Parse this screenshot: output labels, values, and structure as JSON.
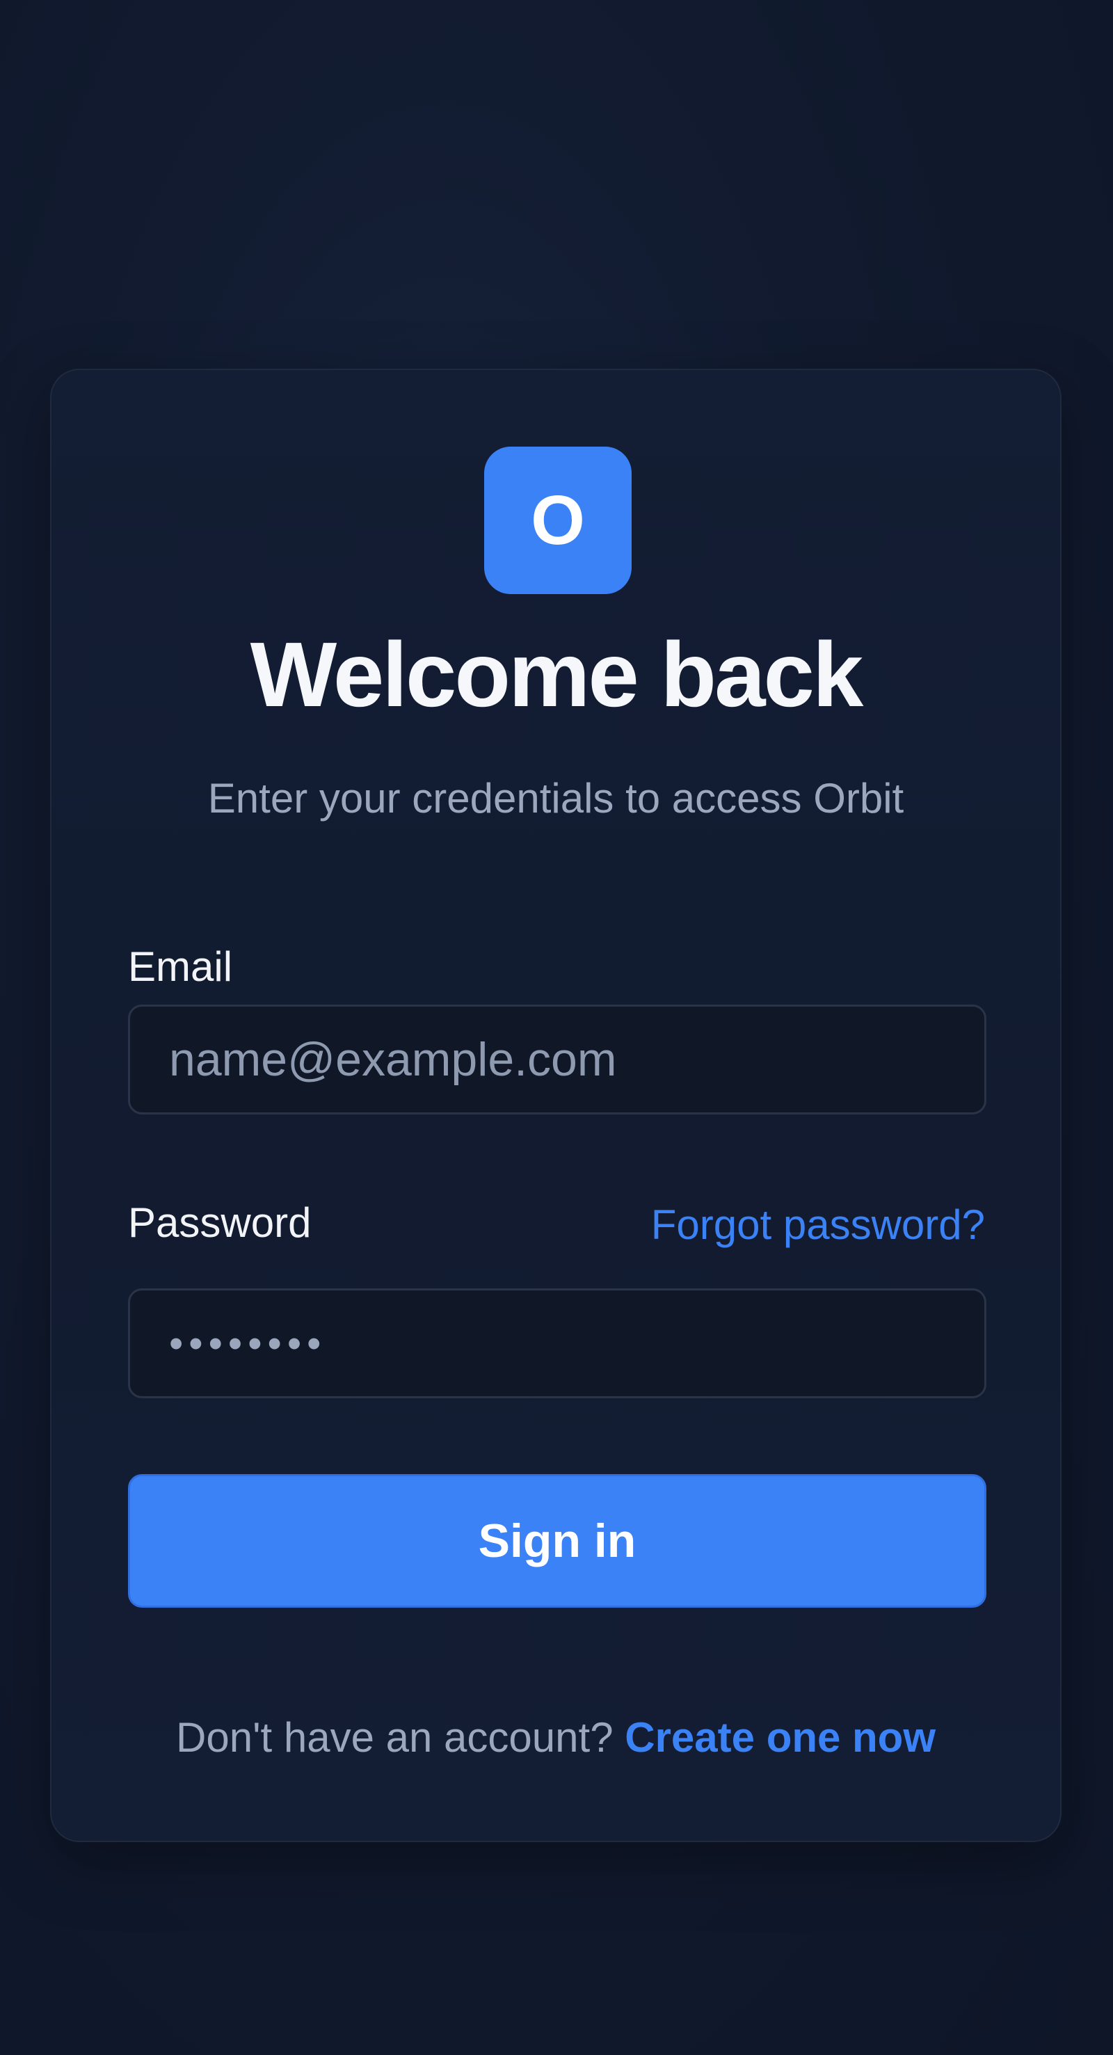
{
  "brand": {
    "logo_letter": "O",
    "accent_color": "#3b82f6"
  },
  "header": {
    "title": "Welcome back",
    "subtitle": "Enter your credentials to access Orbit"
  },
  "form": {
    "email": {
      "label": "Email",
      "placeholder": "name@example.com",
      "value": ""
    },
    "password": {
      "label": "Password",
      "masked_value": "••••••••",
      "forgot_link": "Forgot password?"
    },
    "submit_label": "Sign in"
  },
  "footer": {
    "prompt": "Don't have an account?",
    "link": "Create one now"
  }
}
